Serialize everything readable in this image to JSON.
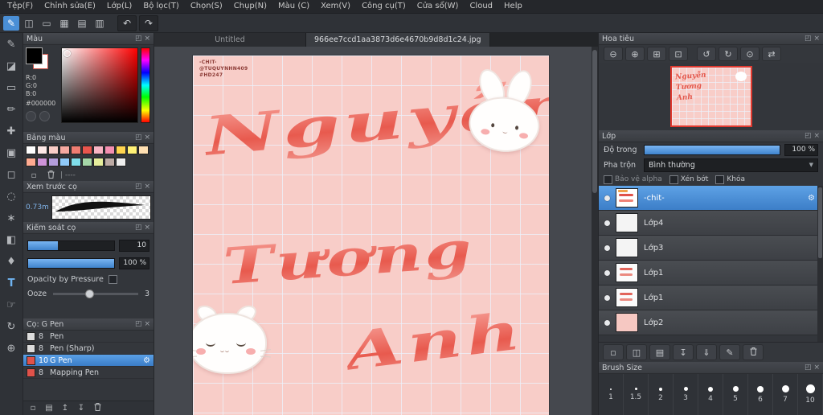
{
  "ui": {
    "popout": "◰",
    "close": "×"
  },
  "colors": {
    "accent": "#4a8fd6",
    "canvas_background": "#f8cdc8",
    "selected_layer": "#4a8fd6",
    "artwork_red": "#e85a4e"
  },
  "menu_bar": {
    "items": [
      "Tệp(F)",
      "Chỉnh sửa(E)",
      "Lớp(L)",
      "Bộ lọc(T)",
      "Chọn(S)",
      "Chụp(N)",
      "Màu (C)",
      "Xem(V)",
      "Công cụ(T)",
      "Cửa sổ(W)",
      "Cloud",
      "Help"
    ]
  },
  "main_toolbar": {
    "icons": [
      {
        "name": "paint-tool",
        "glyph": "✎",
        "active": true
      },
      {
        "name": "clipboard",
        "glyph": "◫",
        "active": false
      },
      {
        "name": "selection",
        "glyph": "▭",
        "active": false
      },
      {
        "name": "grid-toggle",
        "glyph": "▦",
        "active": false
      },
      {
        "name": "ruler",
        "glyph": "▤",
        "active": false
      },
      {
        "name": "material-panel",
        "glyph": "▥",
        "active": false
      }
    ],
    "history": [
      {
        "name": "undo",
        "glyph": "↶"
      },
      {
        "name": "redo",
        "glyph": "↷"
      }
    ]
  },
  "tool_strip": {
    "tools": [
      {
        "name": "pen-tool",
        "glyph": "✎"
      },
      {
        "name": "eraser-tool",
        "glyph": "◪"
      },
      {
        "name": "shape-tool",
        "glyph": "▭"
      },
      {
        "name": "brush-tool",
        "glyph": "✏"
      },
      {
        "name": "move-tool",
        "glyph": "✚"
      },
      {
        "name": "select-rect-tool",
        "glyph": "▣"
      },
      {
        "name": "marquee-tool",
        "glyph": "◻"
      },
      {
        "name": "lasso-tool",
        "glyph": "◌"
      },
      {
        "name": "magic-wand-tool",
        "glyph": "∗"
      },
      {
        "name": "bucket-tool",
        "glyph": "◧"
      },
      {
        "name": "eyedropper-tool",
        "glyph": "♦"
      },
      {
        "name": "text-tool",
        "glyph": "T",
        "accent": true
      },
      {
        "name": "hand-tool",
        "glyph": "☞"
      },
      {
        "name": "rotate-view-tool",
        "glyph": "↻"
      },
      {
        "name": "zoom-tool",
        "glyph": "⊕"
      }
    ]
  },
  "panels": {
    "color": {
      "title": "Màu",
      "r_label": "R:0",
      "g_label": "G:0",
      "b_label": "B:0",
      "hex_value": "#000000"
    },
    "palette": {
      "title": "Bảng màu",
      "swatches": [
        "#ffffff",
        "#fde9e7",
        "#f9cdc7",
        "#f5a8a0",
        "#ef7d72",
        "#e8554d",
        "#f8b4c4",
        "#f48fb1",
        "#ffd54f",
        "#fff176",
        "#ffe0b2",
        "#ffab91",
        "#ce93d8",
        "#b39ddb",
        "#90caf9",
        "#80deea",
        "#a5d6a7",
        "#e6ee9c",
        "#bcaaa4",
        "#eeeeee"
      ],
      "footer_label": "| ----",
      "footer_buttons": [
        {
          "name": "add-swatch",
          "glyph": "▫"
        },
        {
          "name": "delete-swatch",
          "glyph": "trash"
        }
      ]
    },
    "brush_preview": {
      "title": "Xem trước cọ",
      "size_label": "0.73m"
    },
    "brush_control": {
      "title": "Kiểm soát cọ",
      "size_value": "10",
      "opacity_value": "100 %",
      "opacity_by_pressure_label": "Opacity by Pressure",
      "ooze_label": "Ooze",
      "ooze_value": "3"
    },
    "brush_list": {
      "title": "Cọ: G Pen",
      "brushes": [
        {
          "size": "8",
          "name": "Pen",
          "chip": "#dcdcdc",
          "selected": false
        },
        {
          "size": "8",
          "name": "Pen (Sharp)",
          "chip": "#dcdcdc",
          "selected": false
        },
        {
          "size": "10",
          "name": "G Pen",
          "chip": "#e0524a",
          "selected": true
        },
        {
          "size": "8",
          "name": "Mapping Pen",
          "chip": "#e0524a",
          "selected": false
        }
      ],
      "footer_buttons": [
        {
          "name": "add-brush",
          "glyph": "▫"
        },
        {
          "name": "brush-folder",
          "glyph": "▤"
        },
        {
          "name": "brush-up",
          "glyph": "↥"
        },
        {
          "name": "brush-down",
          "glyph": "↧"
        },
        {
          "name": "delete-brush",
          "glyph": "trash"
        }
      ]
    }
  },
  "canvas": {
    "tabs": [
      {
        "label": "Untitled",
        "active": false
      },
      {
        "label": "966ee7ccd1aa3873d6e4670b9d8d1c24.jpg",
        "active": true
      }
    ],
    "annotation": {
      "line1": "-CHIT-",
      "line2": "@TUQUYNHN409",
      "line3": "#HD247"
    },
    "artwork": {
      "word1": "Nguyễn",
      "word2": "Tương",
      "word3": "Anh"
    }
  },
  "navigator": {
    "title": "Hoa tiêu",
    "buttons": [
      {
        "name": "zoom-out",
        "glyph": "⊖"
      },
      {
        "name": "zoom-in",
        "glyph": "⊕"
      },
      {
        "name": "fit-window",
        "glyph": "⊞"
      },
      {
        "name": "actual-size",
        "glyph": "⊡"
      },
      {
        "name": "rotate-ccw",
        "glyph": "↺"
      },
      {
        "name": "rotate-cw",
        "glyph": "↻"
      },
      {
        "name": "reset-rotation",
        "glyph": "⊙"
      },
      {
        "name": "flip-view",
        "glyph": "⇄"
      }
    ]
  },
  "layers_panel": {
    "title": "Lớp",
    "opacity_label": "Độ trong",
    "opacity_value": "100 %",
    "blend_label": "Pha trộn",
    "blend_value": "Bình thường",
    "checkboxes": [
      {
        "label": "Bảo vệ alpha",
        "checked": false
      },
      {
        "label": "Xén bớt",
        "checked": false
      },
      {
        "label": "Khóa",
        "checked": false
      }
    ],
    "layers": [
      {
        "name": "-chit-",
        "thumb": "art",
        "selected": true
      },
      {
        "name": "Lớp4",
        "thumb": "white",
        "selected": false
      },
      {
        "name": "Lớp3",
        "thumb": "white",
        "selected": false
      },
      {
        "name": "Lớp1",
        "thumb": "text",
        "selected": false
      },
      {
        "name": "Lớp1",
        "thumb": "text",
        "selected": false
      },
      {
        "name": "Lớp2",
        "thumb": "pink",
        "selected": false
      }
    ],
    "footer_buttons": [
      {
        "name": "add-layer",
        "glyph": "▫"
      },
      {
        "name": "duplicate-layer",
        "glyph": "◫"
      },
      {
        "name": "add-folder",
        "glyph": "▤"
      },
      {
        "name": "transfer-down",
        "glyph": "↧"
      },
      {
        "name": "merge-down",
        "glyph": "⇓"
      },
      {
        "name": "rename-layer",
        "glyph": "✎"
      },
      {
        "name": "delete-layer",
        "glyph": "trash"
      }
    ]
  },
  "brush_size_panel": {
    "title": "Brush Size",
    "sizes": [
      {
        "label": "1",
        "dot": 2
      },
      {
        "label": "1.5",
        "dot": 3
      },
      {
        "label": "2",
        "dot": 4
      },
      {
        "label": "3",
        "dot": 5
      },
      {
        "label": "4",
        "dot": 6
      },
      {
        "label": "5",
        "dot": 7
      },
      {
        "label": "6",
        "dot": 8
      },
      {
        "label": "7",
        "dot": 9
      },
      {
        "label": "10",
        "dot": 11
      }
    ]
  }
}
